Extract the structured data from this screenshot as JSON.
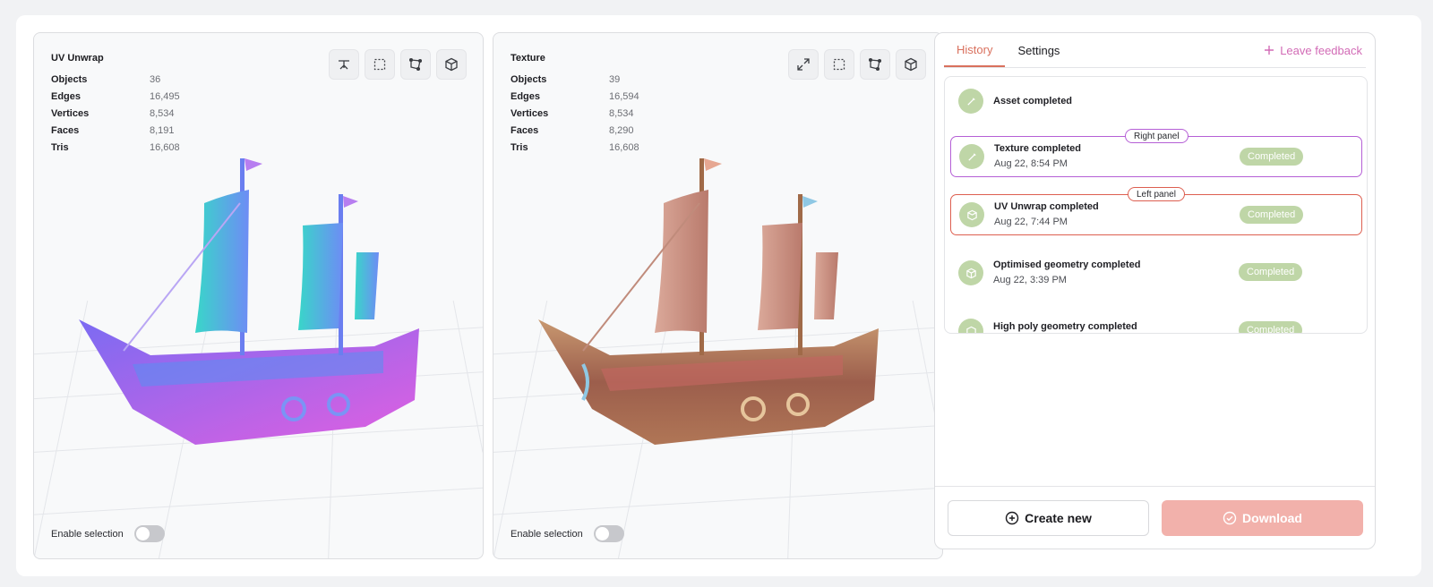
{
  "left_viewer": {
    "title": "UV Unwrap",
    "stats": [
      {
        "label": "Objects",
        "value": "36"
      },
      {
        "label": "Edges",
        "value": "16,495"
      },
      {
        "label": "Vertices",
        "value": "8,534"
      },
      {
        "label": "Faces",
        "value": "8,191"
      },
      {
        "label": "Tris",
        "value": "16,608"
      }
    ],
    "tools": [
      "scissor-icon",
      "selection-box-icon",
      "vertex-path-icon",
      "cube-icon"
    ],
    "selection_label": "Enable selection",
    "selection_enabled": false,
    "ship_colors": {
      "hull": "#8f5bf0",
      "sail": "#4cc6d6"
    }
  },
  "right_viewer": {
    "title": "Texture",
    "stats": [
      {
        "label": "Objects",
        "value": "39"
      },
      {
        "label": "Edges",
        "value": "16,594"
      },
      {
        "label": "Vertices",
        "value": "8,534"
      },
      {
        "label": "Faces",
        "value": "8,290"
      },
      {
        "label": "Tris",
        "value": "16,608"
      }
    ],
    "tools": [
      "expand-icon",
      "selection-box-icon",
      "vertex-path-icon",
      "cube-icon"
    ],
    "selection_label": "Enable selection",
    "selection_enabled": false,
    "ship_colors": {
      "hull": "#b07656",
      "sail": "#d29a8a"
    }
  },
  "sidebar": {
    "tabs": [
      {
        "label": "History",
        "active": true
      },
      {
        "label": "Settings",
        "active": false
      }
    ],
    "feedback_label": "Leave feedback",
    "history": [
      {
        "title": "Asset completed",
        "date": "",
        "status": "",
        "icon": "brush-icon",
        "tag": ""
      },
      {
        "title": "Texture completed",
        "date": "Aug 22, 8:54 PM",
        "status": "Completed",
        "icon": "brush-icon",
        "tag": "Right panel"
      },
      {
        "title": "UV Unwrap completed",
        "date": "Aug 22, 7:44 PM",
        "status": "Completed",
        "icon": "box-icon",
        "tag": "Left panel"
      },
      {
        "title": "Optimised geometry completed",
        "date": "Aug 22, 3:39 PM",
        "status": "Completed",
        "icon": "cube-icon",
        "tag": ""
      },
      {
        "title": "High poly geometry completed",
        "date": "",
        "status": "Completed",
        "icon": "cube-icon",
        "tag": ""
      }
    ],
    "create_label": "Create new",
    "download_label": "Download"
  },
  "colors": {
    "accent": "#d9705d",
    "feedback": "#d26bb6",
    "status_badge": "#bfd6a7",
    "right_panel_outline": "#b55fd6",
    "left_panel_outline": "#dd5f50",
    "download_button": "#f2b1ab"
  }
}
